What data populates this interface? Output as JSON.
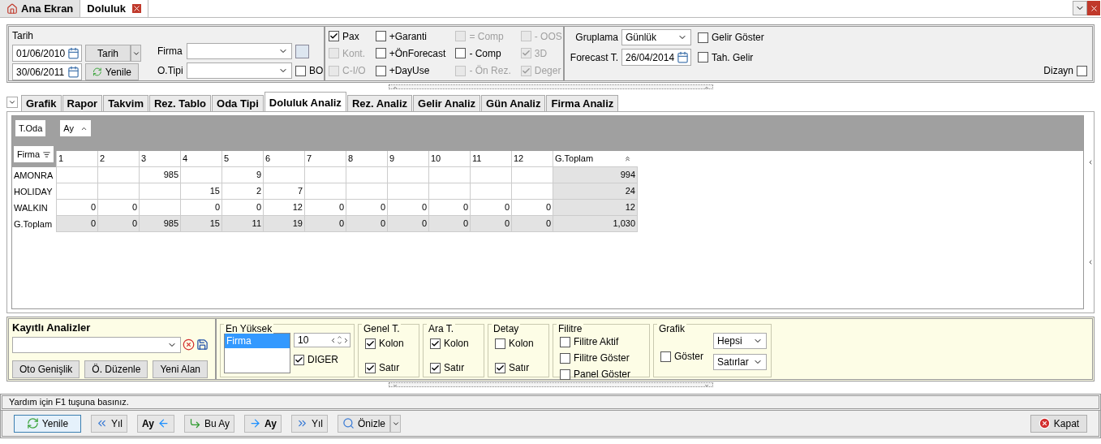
{
  "doc_tabs": [
    {
      "label": "Ana Ekran",
      "selected": false,
      "kind": "home"
    },
    {
      "label": "Doluluk",
      "selected": true,
      "kind": "closable"
    }
  ],
  "filters": {
    "title": "Tarih",
    "date_from": "01/06/2010",
    "date_to": "30/06/2011",
    "tarih_button": "Tarih",
    "yenile_button": "Yenile",
    "firma_label": "Firma",
    "otipi_label": "O.Tipi",
    "bo": {
      "label": "BO",
      "checked": false
    }
  },
  "options": [
    {
      "label": "Pax",
      "checked": true,
      "disabled": false
    },
    {
      "label": "Kont.",
      "checked": false,
      "disabled": true
    },
    {
      "label": "C-I/O",
      "checked": false,
      "disabled": true
    },
    {
      "label": "+Garanti",
      "checked": false,
      "disabled": false
    },
    {
      "label": "+ÖnForecast",
      "checked": false,
      "disabled": false
    },
    {
      "label": "+DayUse",
      "checked": false,
      "disabled": false
    },
    {
      "label": "= Comp",
      "checked": false,
      "disabled": true
    },
    {
      "label": "- Comp",
      "checked": false,
      "disabled": false
    },
    {
      "label": "- Ön Rez.",
      "checked": false,
      "disabled": true
    },
    {
      "label": "- OOS",
      "checked": false,
      "disabled": true
    },
    {
      "label": "3D",
      "checked": true,
      "disabled": true
    },
    {
      "label": "Deger",
      "checked": true,
      "disabled": true
    }
  ],
  "grouping": {
    "label": "Gruplama",
    "value": "Günlük",
    "forecast_label": "Forecast T.",
    "forecast_value": "26/04/2014",
    "gelir_goster": {
      "label": "Gelir Göster",
      "checked": false
    },
    "tah_gelir": {
      "label": "Tah. Gelir",
      "checked": false
    },
    "dizayn": {
      "label": "Dizayn",
      "checked": false
    }
  },
  "analysis_tabs": [
    {
      "label": "Grafik",
      "selected": false
    },
    {
      "label": "Rapor",
      "selected": false
    },
    {
      "label": "Takvim",
      "selected": false
    },
    {
      "label": "Rez. Tablo",
      "selected": false
    },
    {
      "label": "Oda Tipi",
      "selected": false
    },
    {
      "label": "Doluluk Analiz",
      "selected": true
    },
    {
      "label": "Rez. Analiz",
      "selected": false
    },
    {
      "label": "Gelir Analiz",
      "selected": false
    },
    {
      "label": "Gün Analiz",
      "selected": false
    },
    {
      "label": "Firma Analiz",
      "selected": false
    }
  ],
  "pivot": {
    "filter_field": "T.Oda",
    "column_field": "Ay",
    "row_field": "Firma",
    "total_header": "G.Toplam",
    "columns": [
      "1",
      "2",
      "3",
      "4",
      "5",
      "6",
      "7",
      "8",
      "9",
      "10",
      "11",
      "12"
    ],
    "rows": [
      {
        "label": "AMONRA",
        "cells": [
          "",
          "",
          "985",
          "",
          "9",
          "",
          "",
          "",
          "",
          "",
          "",
          ""
        ],
        "total": "994"
      },
      {
        "label": "HOLIDAY",
        "cells": [
          "",
          "",
          "",
          "15",
          "2",
          "7",
          "",
          "",
          "",
          "",
          "",
          ""
        ],
        "total": "24"
      },
      {
        "label": "WALKIN",
        "cells": [
          "0",
          "0",
          "",
          "0",
          "0",
          "12",
          "0",
          "0",
          "0",
          "0",
          "0",
          "0"
        ],
        "total": "12"
      }
    ],
    "grand_total": {
      "label": "G.Toplam",
      "cells": [
        "0",
        "0",
        "985",
        "15",
        "11",
        "19",
        "0",
        "0",
        "0",
        "0",
        "0",
        "0"
      ],
      "total": "1,030"
    }
  },
  "saved": {
    "title": "Kayıtlı Analizler",
    "buttons": [
      "Oto Genişlik",
      "Ö. Düzenle",
      "Yeni Alan"
    ]
  },
  "en_yuksek": {
    "title": "En Yüksek",
    "list": [
      {
        "label": "Firma",
        "selected": true
      }
    ],
    "count": "10",
    "diger": {
      "label": "DIGER",
      "checked": true
    }
  },
  "groups": [
    {
      "title": "Genel T.",
      "items": [
        {
          "label": "Kolon",
          "checked": true
        },
        {
          "label": "Satır",
          "checked": true
        }
      ]
    },
    {
      "title": "Ara T.",
      "items": [
        {
          "label": "Kolon",
          "checked": true
        },
        {
          "label": "Satır",
          "checked": true
        }
      ]
    },
    {
      "title": "Detay",
      "items": [
        {
          "label": "Kolon",
          "checked": false
        },
        {
          "label": "Satır",
          "checked": true
        }
      ]
    },
    {
      "title": "Filitre",
      "items": [
        {
          "label": "Filitre Aktif",
          "checked": false
        },
        {
          "label": "Filitre Göster",
          "checked": false
        },
        {
          "label": "Panel Göster",
          "checked": false
        }
      ]
    }
  ],
  "grafik": {
    "title": "Grafik",
    "goster": {
      "label": "Göster",
      "checked": false
    },
    "select_1": "Hepsi",
    "select_2": "Satırlar"
  },
  "status": "Yardım için F1 tuşuna basınız.",
  "toolbar": [
    {
      "label": "Yenile",
      "kind": "refresh"
    },
    {
      "label": "Yıl",
      "kind": "prev-year"
    },
    {
      "label": "Ay",
      "kind": "prev-month"
    },
    {
      "label": "Bu Ay",
      "kind": "this-month"
    },
    {
      "label": "Ay",
      "kind": "next-month"
    },
    {
      "label": "Yıl",
      "kind": "next-year"
    },
    {
      "label": "Önizle",
      "kind": "preview"
    }
  ],
  "close_button": "Kapat"
}
